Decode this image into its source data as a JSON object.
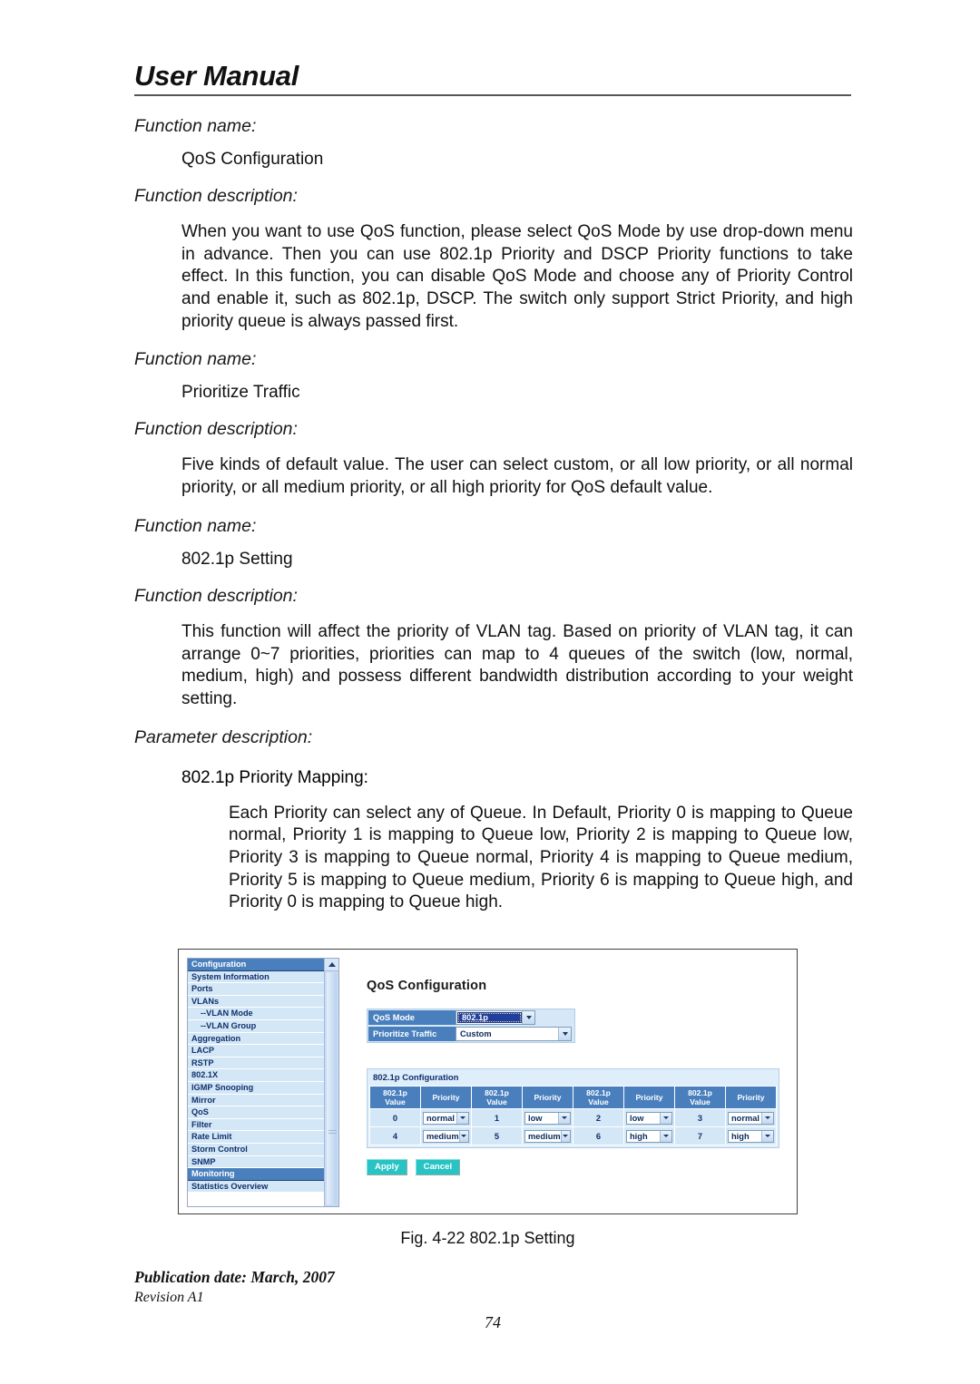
{
  "header": {
    "title": "User Manual"
  },
  "sections": [
    {
      "label": "Function name:",
      "value": "QoS Configuration",
      "desc_label": "Function description:",
      "desc": "When you want to use QoS function, please select QoS Mode by use drop-down menu in advance. Then you can use 802.1p Priority and DSCP Priority functions to take effect. In this function, you can disable QoS Mode and choose any of Priority Control and enable it, such as 802.1p, DSCP. The switch only support Strict Priority, and high priority queue is always passed first."
    },
    {
      "label": "Function name:",
      "value": "Prioritize Traffic",
      "desc_label": "Function description:",
      "desc": "Five kinds of default value. The user can select custom, or all low priority, or all normal priority, or all medium priority, or all high priority for QoS default value."
    },
    {
      "label": "Function name:",
      "value": "802.1p Setting",
      "desc_label": "Function description:",
      "desc": "This function will affect the priority of VLAN tag. Based on priority of VLAN tag, it can arrange 0~7 priorities, priorities can map to 4 queues of the switch (low, normal, medium, high) and possess different bandwidth distribution according to your weight setting."
    }
  ],
  "parameter": {
    "label": "Parameter description:",
    "sub_head": "802.1p Priority Mapping:",
    "desc": "Each Priority can select any of Queue. In Default, Priority 0 is mapping to Queue normal, Priority 1 is mapping to Queue low, Priority 2 is mapping to Queue low, Priority 3 is mapping to Queue normal, Priority 4 is mapping to Queue medium, Priority 5 is mapping to Queue medium, Priority 6 is mapping to Queue high, and Priority 0 is mapping to Queue high."
  },
  "figure": {
    "caption": "Fig. 4-22 802.1p Setting",
    "sidebar": {
      "items": [
        {
          "label": "Configuration",
          "type": "group"
        },
        {
          "label": "System Information",
          "type": "item"
        },
        {
          "label": "Ports",
          "type": "item"
        },
        {
          "label": "VLANs",
          "type": "item"
        },
        {
          "label": "--VLAN Mode",
          "type": "sub"
        },
        {
          "label": "--VLAN Group",
          "type": "sub"
        },
        {
          "label": "Aggregation",
          "type": "item"
        },
        {
          "label": "LACP",
          "type": "item"
        },
        {
          "label": "RSTP",
          "type": "item"
        },
        {
          "label": "802.1X",
          "type": "item"
        },
        {
          "label": "IGMP Snooping",
          "type": "item"
        },
        {
          "label": "Mirror",
          "type": "item"
        },
        {
          "label": "QoS",
          "type": "item"
        },
        {
          "label": "Filter",
          "type": "item"
        },
        {
          "label": "Rate Limit",
          "type": "item"
        },
        {
          "label": "Storm Control",
          "type": "item"
        },
        {
          "label": "SNMP",
          "type": "item"
        },
        {
          "label": "Monitoring",
          "type": "group"
        },
        {
          "label": "Statistics Overview",
          "type": "item"
        }
      ]
    },
    "panel": {
      "title": "QoS Configuration",
      "qos_mode_label": "QoS Mode",
      "qos_mode_value": "802.1p",
      "prioritize_label": "Prioritize Traffic",
      "prioritize_value": "Custom",
      "table_title": "802.1p Configuration",
      "col_value_header": "802.1p\nValue",
      "col_value_header_line1": "802.1p",
      "col_value_header_line2": "Value",
      "col_priority_header": "Priority",
      "rows": [
        [
          {
            "value": "0",
            "priority": "normal"
          },
          {
            "value": "1",
            "priority": "low"
          },
          {
            "value": "2",
            "priority": "low"
          },
          {
            "value": "3",
            "priority": "normal"
          }
        ],
        [
          {
            "value": "4",
            "priority": "medium"
          },
          {
            "value": "5",
            "priority": "medium"
          },
          {
            "value": "6",
            "priority": "high"
          },
          {
            "value": "7",
            "priority": "high"
          }
        ]
      ],
      "apply_label": "Apply",
      "cancel_label": "Cancel"
    },
    "colors": {
      "header_blue": "#4a7fbd",
      "cell_blue": "#d3e7f7",
      "button_teal": "#28c3c3",
      "selected_blue": "#1f3f9e"
    }
  },
  "footer": {
    "publication": "Publication date: March, 2007",
    "revision": "Revision A1",
    "page_number": "74"
  }
}
